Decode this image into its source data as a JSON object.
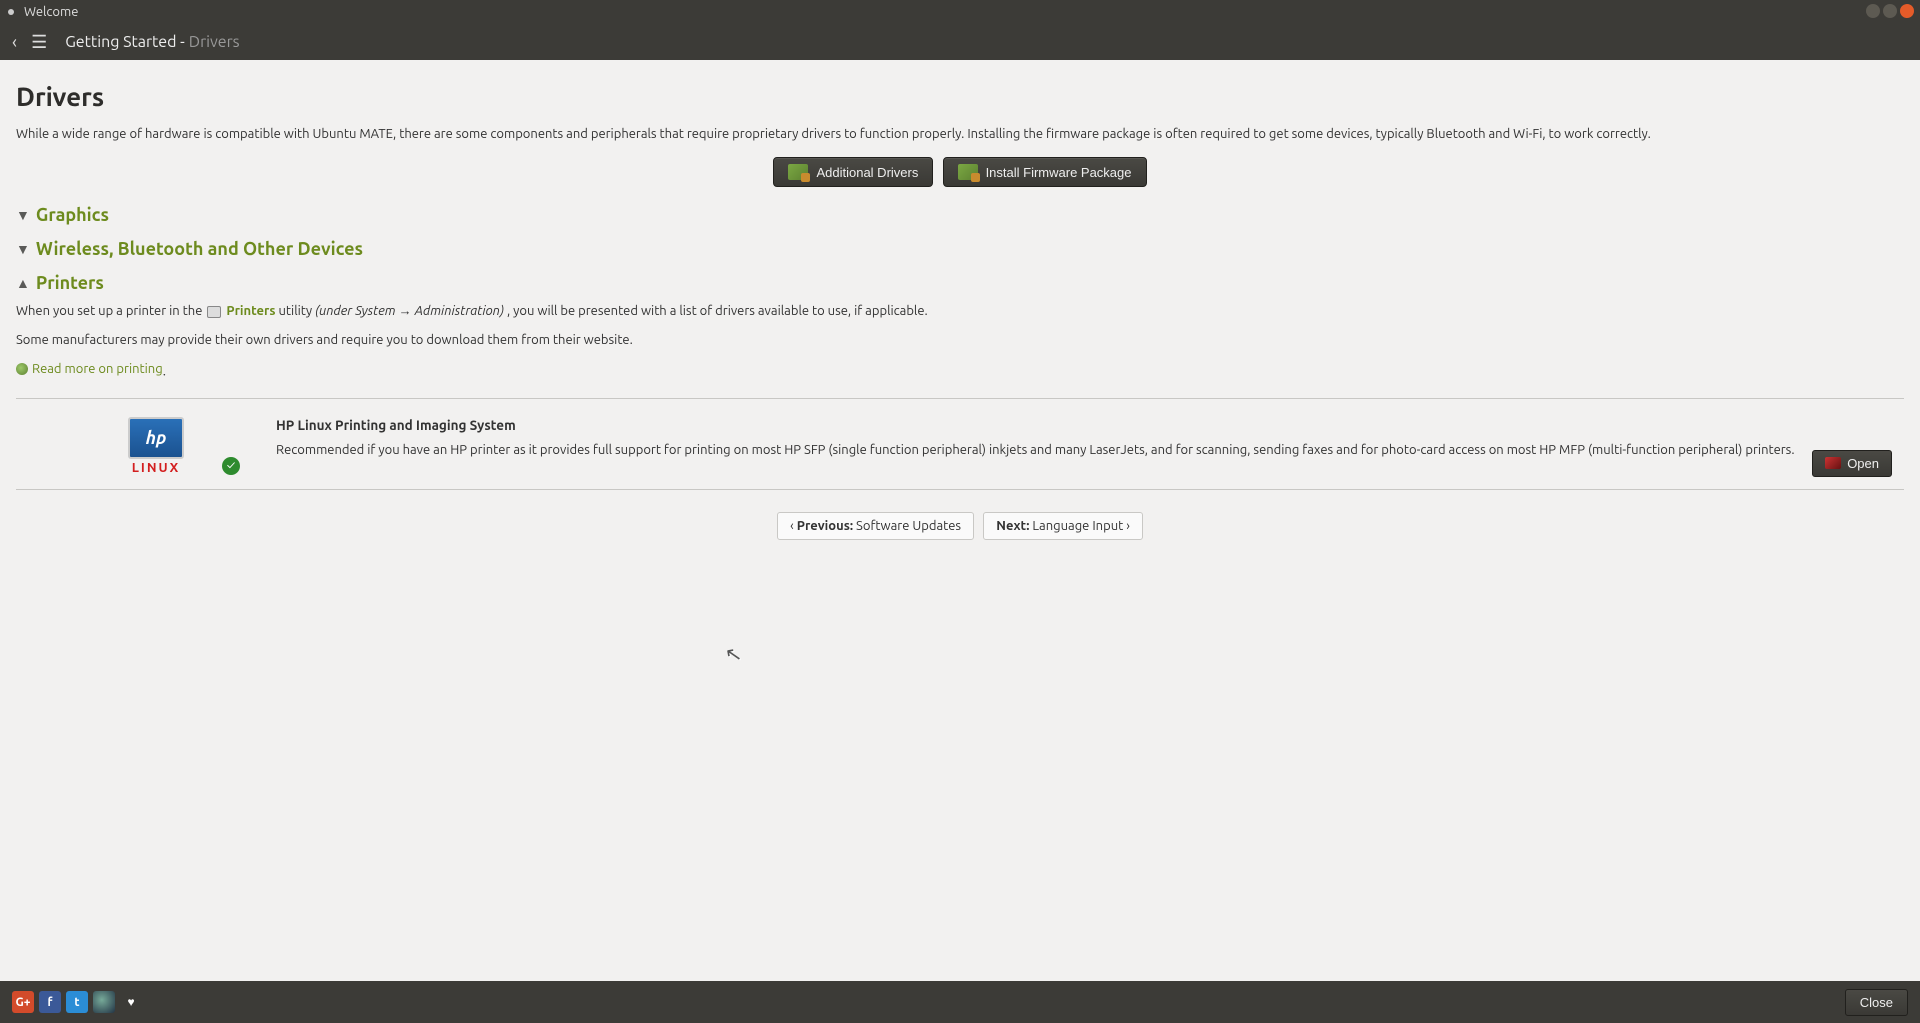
{
  "window": {
    "title": "Welcome"
  },
  "header": {
    "crumb1": "Getting Started -",
    "crumb2": "Drivers"
  },
  "page": {
    "title": "Drivers",
    "intro": "While a wide range of hardware is compatible with Ubuntu MATE, there are some components and peripherals that require proprietary drivers to function properly. Installing the firmware package is often required to get some devices, typically Bluetooth and Wi-Fi, to work correctly.",
    "btn_additional": "Additional Drivers",
    "btn_firmware": "Install Firmware Package"
  },
  "sections": {
    "graphics": "Graphics",
    "wireless": "Wireless, Bluetooth and Other Devices",
    "printers": "Printers"
  },
  "printers": {
    "p1a": "When you set up a printer in the ",
    "p1_link": "Printers",
    "p1b": " utility ",
    "p1_italic": "(under System → Administration)",
    "p1c": ", you will be presented with a list of drivers available to use, if applicable.",
    "p2": "Some manufacturers may provide their own drivers and require you to download them from their website.",
    "readmore": "Read more on printing",
    "period": "."
  },
  "hp": {
    "logo_text": "hp",
    "logo_sub": "LINUX",
    "title": "HP Linux Printing and Imaging System",
    "desc": "Recommended if you have an HP printer as it provides full support for printing on most HP SFP (single function peripheral) inkjets and many LaserJets, and for scanning, sending faxes and for photo-card access on most HP MFP (multi-function peripheral) printers.",
    "open": "Open"
  },
  "pager": {
    "prev_label": "Previous:",
    "prev_value": "Software Updates",
    "next_label": "Next:",
    "next_value": "Language Input"
  },
  "footer": {
    "close": "Close",
    "gp": "G+",
    "fb": "f",
    "tw": "t",
    "heart": "♥"
  }
}
